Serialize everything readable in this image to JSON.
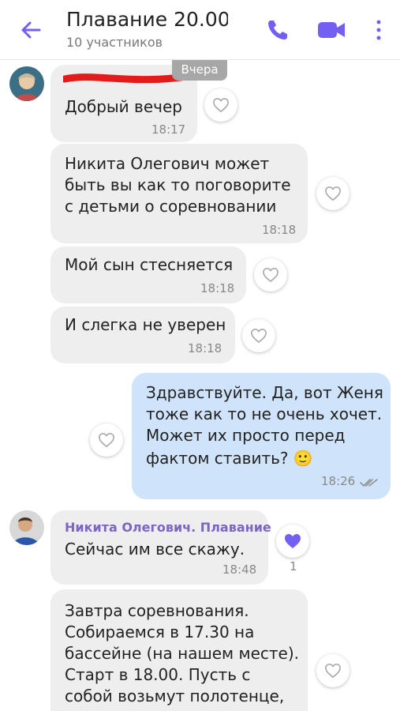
{
  "header": {
    "title": "Плавание 20.00…",
    "subtitle": "10 участников"
  },
  "chat": {
    "date_divider": "Вчера",
    "messages": [
      {
        "lines": [
          "Добрый вечер"
        ],
        "time": "18:17"
      },
      {
        "lines": [
          "Никита Олегович может",
          "быть вы как то поговорите",
          "с детьми о соревновании"
        ],
        "time": "18:18"
      },
      {
        "lines": [
          "Мой сын стесняется"
        ],
        "time": "18:18"
      },
      {
        "lines": [
          "И слегка не уверен"
        ],
        "time": "18:18"
      },
      {
        "lines": [
          "Здравствуйте. Да, вот Женя",
          "тоже как то не очень хочет.",
          "Может их просто перед",
          "фактом ставить? 🙂"
        ],
        "time": "18:26"
      },
      {
        "sender": "Никита Олегович. Плавание",
        "lines": [
          "Сейчас им все скажу."
        ],
        "time": "18:48",
        "likes": "1"
      },
      {
        "lines": [
          "Завтра соревнования.",
          "Собираемся в 17.30 на",
          "бассейне (на нашем месте).",
          "Старт в 18.00. Пусть с",
          "собой возьмут полотенце,"
        ]
      }
    ]
  },
  "colors": {
    "accent": "#7360f2",
    "incoming_bubble": "#eeeeee",
    "outgoing_bubble": "#cfe4fb"
  }
}
